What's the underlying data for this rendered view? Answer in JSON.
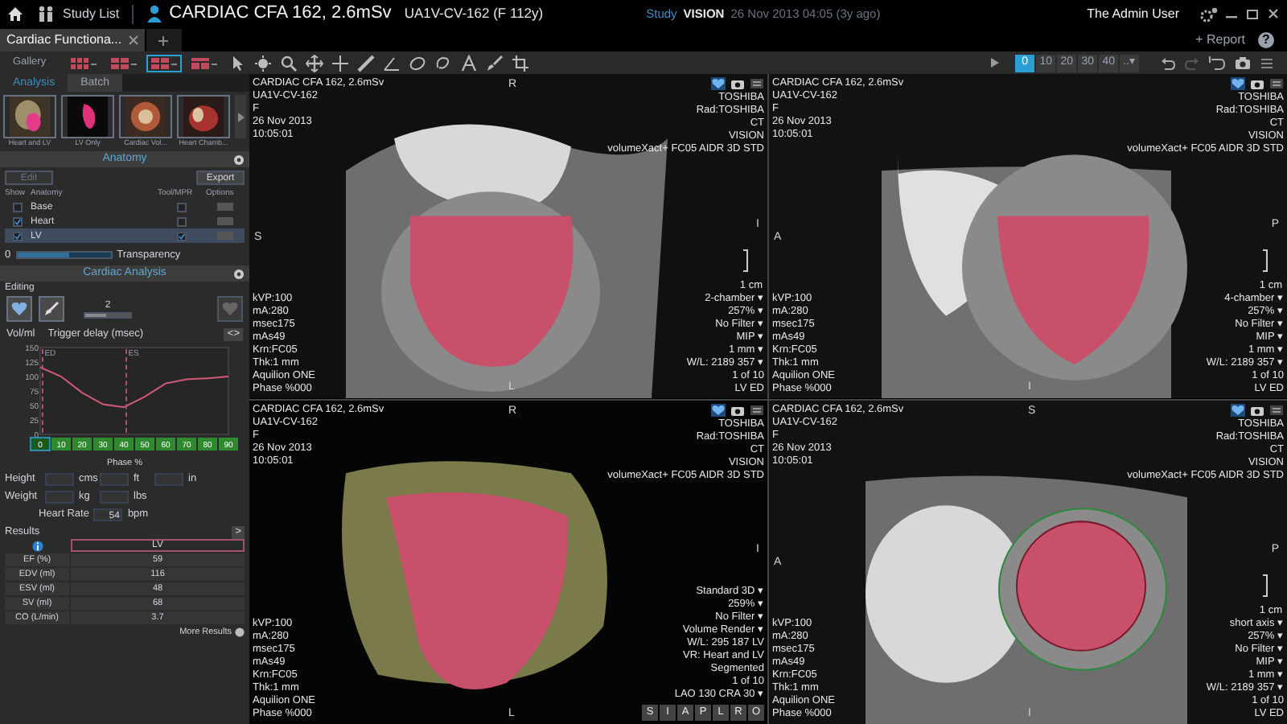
{
  "titlebar": {
    "study_list": "Study List",
    "patient": "CARDIAC CFA 162, 2.6mSv",
    "patient_id": "UA1V-CV-162 (F 112y)",
    "study_label": "Study",
    "study_name": "VISION",
    "study_date": "26 Nov 2013 04:05 (3y ago)",
    "user": "The Admin User"
  },
  "tabs": [
    {
      "label": "Cardiac Functiona...",
      "selected": true
    }
  ],
  "report": "+ Report",
  "help": "?",
  "toolbar": {
    "gallery": "Gallery",
    "layouts": [
      {
        "selected": false
      },
      {
        "selected": false
      },
      {
        "selected": true
      },
      {
        "selected": false
      }
    ],
    "phase_buttons": [
      {
        "label": "0",
        "selected": true
      },
      {
        "label": "10",
        "selected": false
      },
      {
        "label": "20",
        "selected": false
      },
      {
        "label": "30",
        "selected": false
      },
      {
        "label": "40",
        "selected": false
      }
    ],
    "more": "..▾"
  },
  "left_panel": {
    "tabs": [
      {
        "label": "Analysis",
        "selected": true
      },
      {
        "label": "Batch",
        "selected": false
      }
    ],
    "presets": [
      {
        "label": "Heart and LV",
        "kind": "heart-lv"
      },
      {
        "label": "LV Only",
        "kind": "lv"
      },
      {
        "label": "Cardiac Vol...",
        "kind": "cardiac"
      },
      {
        "label": "Heart Chamb...",
        "kind": "chambers"
      }
    ],
    "anatomy": {
      "title": "Anatomy",
      "edit": {
        "label": "Edit",
        "disabled": true
      },
      "export": "Export",
      "columns": [
        "Show",
        "Anatomy",
        "Tool/MPR",
        "Options"
      ],
      "rows": [
        {
          "name": "Base",
          "show": false,
          "mpr": false,
          "selected": false
        },
        {
          "name": "Heart",
          "show": true,
          "mpr": false,
          "selected": false
        },
        {
          "name": "LV",
          "show": true,
          "mpr": true,
          "selected": true
        }
      ],
      "transparency": {
        "min": "0",
        "level": 0.55,
        "label": "Transparency"
      }
    },
    "cardiac": {
      "title": "Cardiac Analysis",
      "editing": "Editing",
      "brush_size": {
        "value": "2",
        "level": 0.45
      },
      "y_selector": "Vol/ml",
      "x_selector": "Trigger delay (msec)",
      "expand": "<>",
      "chart_data": {
        "type": "line",
        "x": [
          0,
          10,
          20,
          30,
          40,
          50,
          60,
          70,
          80,
          90
        ],
        "series": [
          {
            "color": "#d05a78",
            "values": [
              116,
              100,
              72,
              52,
              47,
              65,
              88,
              95,
              97,
              100
            ]
          }
        ],
        "ylim": [
          0,
          150
        ],
        "yticks": [
          0,
          25,
          50,
          75,
          100,
          125,
          150
        ]
      },
      "phases": [
        {
          "label": "0",
          "selected": true,
          "marker": "ED"
        },
        {
          "label": "10",
          "selected": false
        },
        {
          "label": "20",
          "selected": false
        },
        {
          "label": "30",
          "selected": false
        },
        {
          "label": "40",
          "selected": false,
          "marker": "ES"
        },
        {
          "label": "50",
          "selected": false
        },
        {
          "label": "60",
          "selected": false
        },
        {
          "label": "70",
          "selected": false
        },
        {
          "label": "80",
          "selected": false
        },
        {
          "label": "90",
          "selected": false
        }
      ],
      "phase_label": "Phase %",
      "height": {
        "label": "Height",
        "units": [
          "cms",
          "ft",
          "in"
        ]
      },
      "weight": {
        "label": "Weight",
        "units": [
          "kg",
          "lbs"
        ]
      },
      "heart_rate": {
        "label": "Heart Rate",
        "value": "54",
        "unit": "bpm"
      },
      "results": {
        "title": "Results",
        "expand": ">",
        "column": "LV",
        "rows": [
          {
            "label": "EF (%)",
            "value": "59"
          },
          {
            "label": "EDV (ml)",
            "value": "116"
          },
          {
            "label": "ESV (ml)",
            "value": "48"
          },
          {
            "label": "SV (ml)",
            "value": "68"
          },
          {
            "label": "CO (L/min)",
            "value": "3.7"
          }
        ],
        "more": "More Results"
      }
    }
  },
  "viewports": [
    {
      "kind": "long-axis",
      "patient": [
        "CARDIAC CFA 162, 2.6mSv",
        "UA1V-CV-162",
        "F",
        "26 Nov 2013",
        "10:05:01"
      ],
      "scanner": [
        "TOSHIBA",
        "Rad:TOSHIBA",
        "CT",
        "VISION",
        "volumeXact+ FC05 AIDR 3D STD"
      ],
      "acquisition": [
        "kVP:100",
        "mA:280",
        "msec175",
        "mAs49",
        "Krn:FC05",
        "Thk:1 mm",
        "Aquilion ONE",
        "Phase %000"
      ],
      "view": [
        "2-chamber ▾",
        "257% ▾",
        "No Filter ▾",
        "MIP ▾",
        "1 mm ▾",
        "W/L: 2189 357 ▾",
        "1 of 10",
        "LV ED"
      ],
      "markers": {
        "top": "R",
        "left": "S",
        "right": "I",
        "bottom": "L"
      },
      "scale": "1 cm"
    },
    {
      "kind": "four-chamber",
      "patient": [
        "CARDIAC CFA 162, 2.6mSv",
        "UA1V-CV-162",
        "F",
        "26 Nov 2013",
        "10:05:01"
      ],
      "scanner": [
        "TOSHIBA",
        "Rad:TOSHIBA",
        "CT",
        "VISION",
        "volumeXact+ FC05 AIDR 3D STD"
      ],
      "acquisition": [
        "kVP:100",
        "mA:280",
        "msec175",
        "mAs49",
        "Krn:FC05",
        "Thk:1 mm",
        "Aquilion ONE",
        "Phase %000"
      ],
      "view": [
        "4-chamber ▾",
        "257% ▾",
        "No Filter ▾",
        "MIP ▾",
        "1 mm ▾",
        "W/L: 2189 357 ▾",
        "1 of 10",
        "LV ED"
      ],
      "markers": {
        "left": "A",
        "right": "P",
        "bottom": "I"
      },
      "scale": "1 cm"
    },
    {
      "kind": "volume",
      "patient": [
        "CARDIAC CFA 162, 2.6mSv",
        "UA1V-CV-162",
        "F",
        "26 Nov 2013",
        "10:05:01"
      ],
      "scanner": [
        "TOSHIBA",
        "Rad:TOSHIBA",
        "CT",
        "VISION",
        "volumeXact+ FC05 AIDR 3D STD"
      ],
      "acquisition": [
        "kVP:100",
        "mA:280",
        "msec175",
        "mAs49",
        "Krn:FC05",
        "Thk:1 mm",
        "Aquilion ONE",
        "Phase %000"
      ],
      "view": [
        "Standard 3D ▾",
        "259% ▾",
        "No Filter ▾",
        "Volume Render ▾",
        "W/L: 295 187 LV",
        "VR: Heart and LV",
        "Segmented",
        "1 of 10",
        "LAO 130  CRA 30 ▾"
      ],
      "markers": {
        "top": "R",
        "right": "I",
        "bottom": "L"
      },
      "orientations": [
        "S",
        "I",
        "A",
        "P",
        "L",
        "R",
        "O"
      ]
    },
    {
      "kind": "short-axis",
      "patient": [
        "CARDIAC CFA 162, 2.6mSv",
        "UA1V-CV-162",
        "F",
        "26 Nov 2013",
        "10:05:01"
      ],
      "scanner": [
        "TOSHIBA",
        "Rad:TOSHIBA",
        "CT",
        "VISION",
        "volumeXact+ FC05 AIDR 3D STD"
      ],
      "acquisition": [
        "kVP:100",
        "mA:280",
        "msec175",
        "mAs49",
        "Krn:FC05",
        "Thk:1 mm",
        "Aquilion ONE",
        "Phase %000"
      ],
      "view": [
        "short axis ▾",
        "257% ▾",
        "No Filter ▾",
        "MIP ▾",
        "1 mm ▾",
        "W/L: 2189 357 ▾",
        "1 of 10",
        "LV ED"
      ],
      "markers": {
        "top": "S",
        "left": "A",
        "right": "P",
        "bottom": "I"
      },
      "scale": "1 cm"
    }
  ]
}
